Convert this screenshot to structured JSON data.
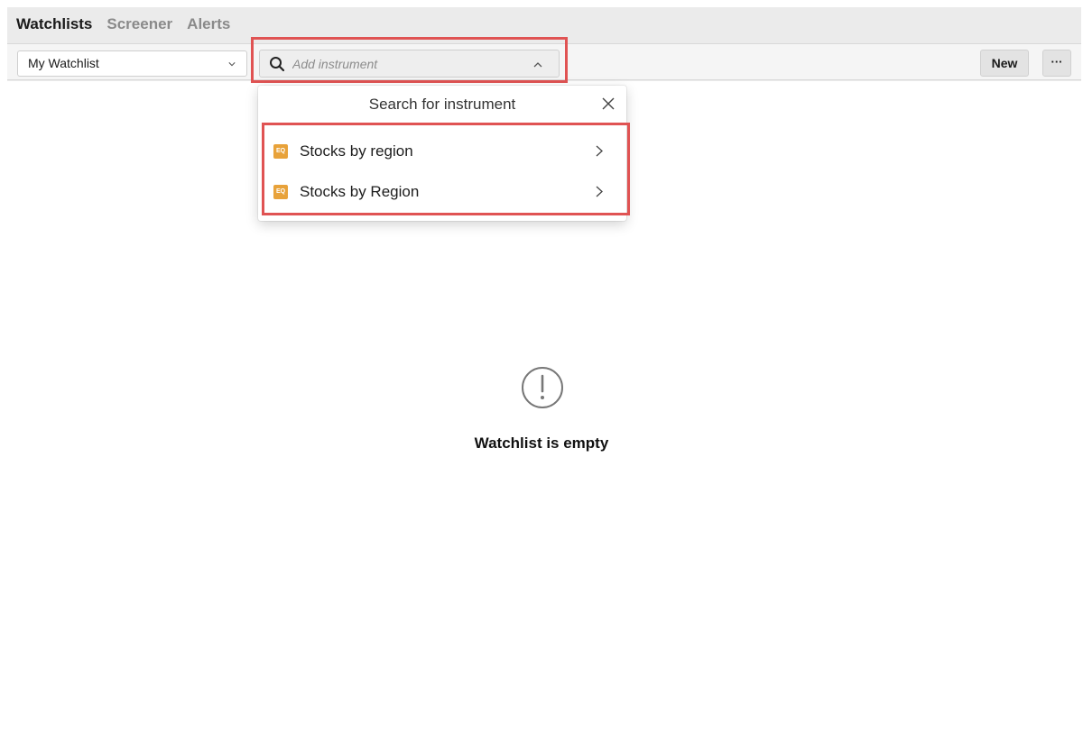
{
  "tabs": [
    {
      "label": "Watchlists",
      "active": true
    },
    {
      "label": "Screener",
      "active": false
    },
    {
      "label": "Alerts",
      "active": false
    }
  ],
  "toolbar": {
    "watchlist_select": "My Watchlist",
    "search_placeholder": "Add instrument",
    "new_label": "New",
    "more_label": "···"
  },
  "dropdown": {
    "title": "Search for instrument",
    "items": [
      {
        "badge": "EQ",
        "label": "Stocks by region"
      },
      {
        "badge": "EQ",
        "label": "Stocks by Region"
      }
    ]
  },
  "empty_state": {
    "icon": "exclamation-circle-icon",
    "message": "Watchlist is empty"
  },
  "colors": {
    "highlight": "#e05353",
    "equity_badge": "#e8a23a"
  }
}
